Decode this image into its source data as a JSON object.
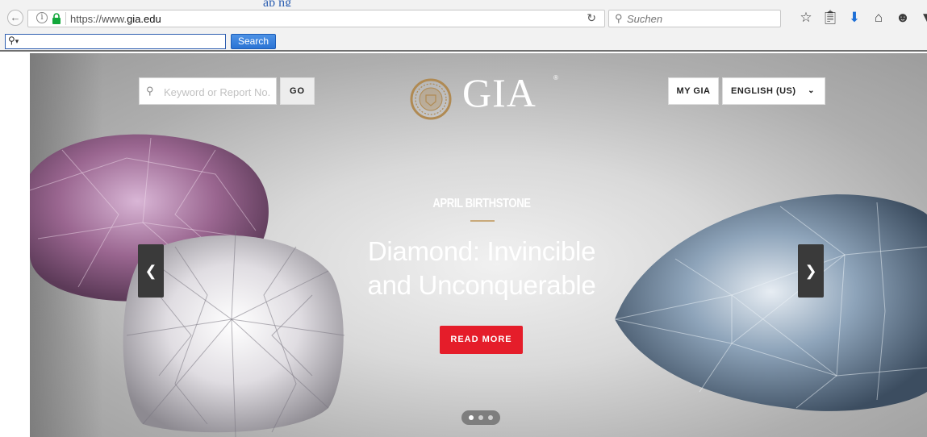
{
  "browser": {
    "top_title_fragment": "ap  ng",
    "url_prefix": "https://www.",
    "url_domain": "gia.edu",
    "search_placeholder": "Suchen",
    "toolbar_search_button": "Search",
    "toolbar_search_dropdown": "▾"
  },
  "header": {
    "keyword_placeholder": "Keyword or Report No.",
    "go_label": "GO",
    "logo_text": "GIA",
    "logo_reg": "®",
    "my_gia_label": "MY GIA",
    "language_label": "ENGLISH (US)"
  },
  "slide": {
    "eyebrow": "APRIL BIRTHSTONE",
    "headline_line1": "Diamond: Invincible",
    "headline_line2": "and Unconquerable",
    "cta_label": "READ MORE",
    "current_index": 1,
    "total": 3
  },
  "colors": {
    "cta": "#e51d2a",
    "logo_gold": "#b08a53",
    "rule_gold": "#c8a97a"
  }
}
